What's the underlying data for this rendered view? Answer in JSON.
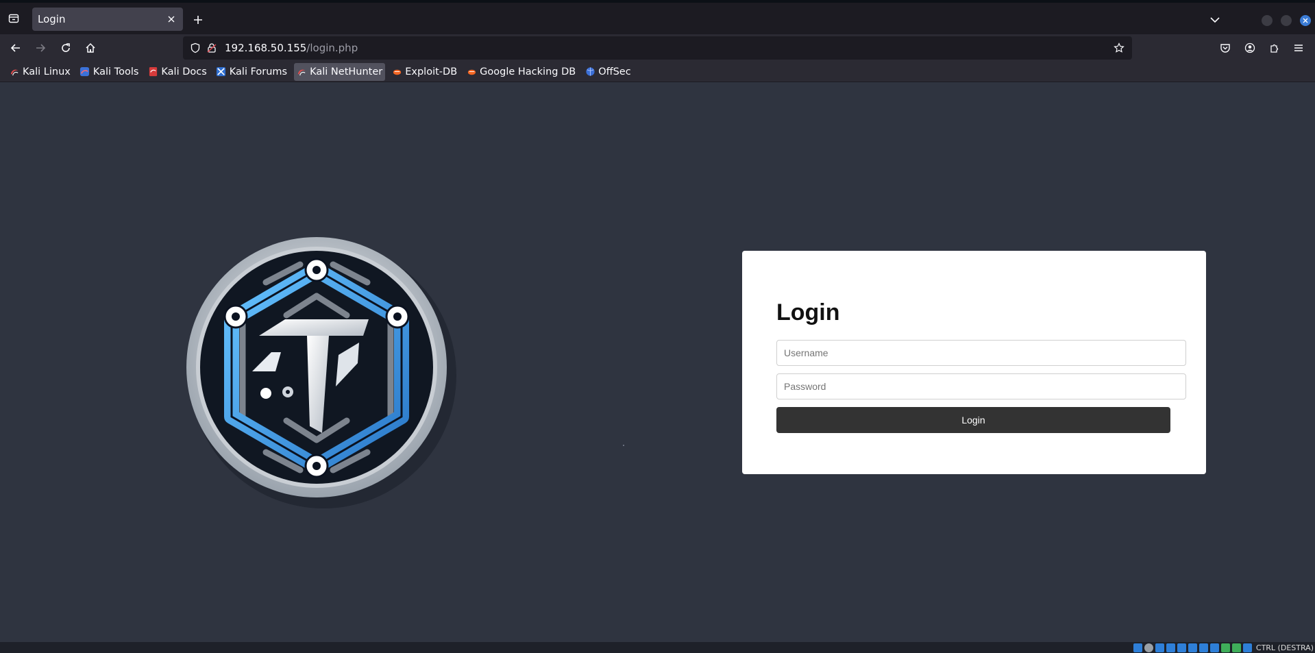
{
  "browser": {
    "tab_title": "Login",
    "url_host": "192.168.50.155",
    "url_path": "/login.php"
  },
  "bookmarks": [
    {
      "label": "Kali Linux",
      "icon": "kali-icon"
    },
    {
      "label": "Kali Tools",
      "icon": "kali-tools-icon"
    },
    {
      "label": "Kali Docs",
      "icon": "kali-docs-icon"
    },
    {
      "label": "Kali Forums",
      "icon": "kali-forums-icon"
    },
    {
      "label": "Kali NetHunter",
      "icon": "kali-nethunter-icon"
    },
    {
      "label": "Exploit-DB",
      "icon": "exploit-db-icon"
    },
    {
      "label": "Google Hacking DB",
      "icon": "ghdb-icon"
    },
    {
      "label": "OffSec",
      "icon": "offsec-icon"
    }
  ],
  "login": {
    "title": "Login",
    "username_placeholder": "Username",
    "password_placeholder": "Password",
    "button_label": "Login"
  },
  "statusbar": {
    "keyboard_label": "CTRL (DESTRA)"
  },
  "colors": {
    "page_bg": "#2f3440",
    "card_bg": "#ffffff",
    "button_bg": "#333333",
    "logo_blue": "#3d9be0"
  }
}
